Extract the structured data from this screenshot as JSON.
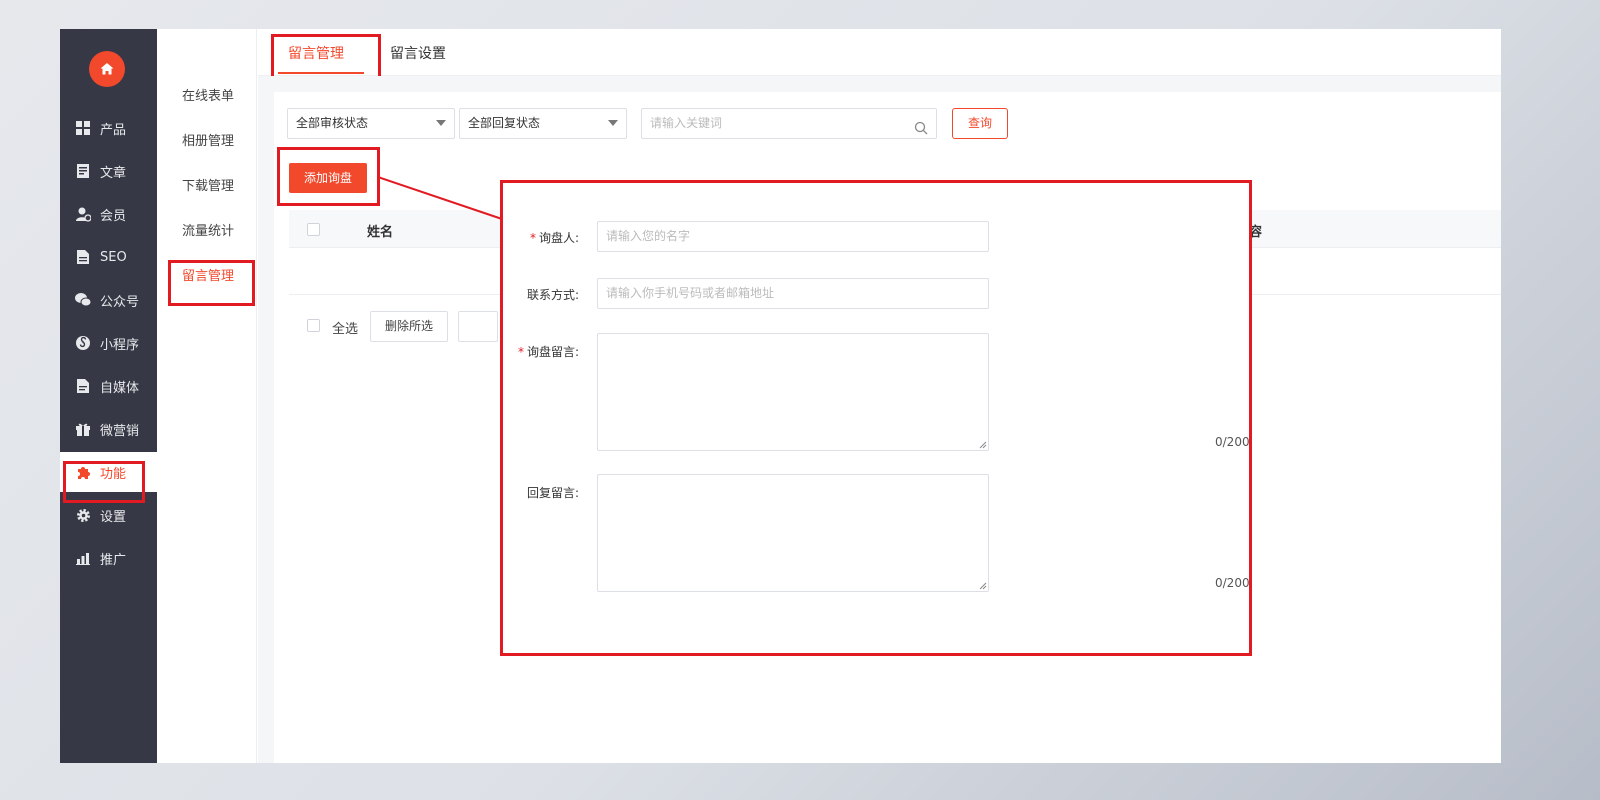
{
  "sidebar": {
    "items": [
      {
        "label": "产品",
        "icon": "grid-icon"
      },
      {
        "label": "文章",
        "icon": "document-icon"
      },
      {
        "label": "会员",
        "icon": "member-icon"
      },
      {
        "label": "SEO",
        "icon": "file-icon"
      },
      {
        "label": "公众号",
        "icon": "wechat-icon"
      },
      {
        "label": "小程序",
        "icon": "miniprogram-icon"
      },
      {
        "label": "自媒体",
        "icon": "media-icon"
      },
      {
        "label": "微营销",
        "icon": "gift-icon"
      },
      {
        "label": "功能",
        "icon": "puzzle-icon",
        "active": true
      },
      {
        "label": "设置",
        "icon": "gear-icon"
      },
      {
        "label": "推广",
        "icon": "chart-icon"
      }
    ]
  },
  "subnav": {
    "items": [
      {
        "label": "在线表单"
      },
      {
        "label": "相册管理"
      },
      {
        "label": "下载管理"
      },
      {
        "label": "流量统计"
      },
      {
        "label": "留言管理",
        "active": true
      }
    ]
  },
  "tabs": [
    {
      "label": "留言管理",
      "active": true
    },
    {
      "label": "留言设置"
    }
  ],
  "filters": {
    "audit_status": "全部审核状态",
    "reply_status": "全部回复状态",
    "keyword_placeholder": "请输入关键词",
    "query_label": "查询"
  },
  "add_button": "添加询盘",
  "table": {
    "columns": [
      "姓名",
      "容"
    ]
  },
  "bulk": {
    "select_all": "全选",
    "delete_selected": "删除所选"
  },
  "form": {
    "inquirer_label": "询盘人:",
    "inquirer_placeholder": "请输入您的名字",
    "contact_label": "联系方式:",
    "contact_placeholder": "请输入你手机号码或者邮箱地址",
    "message_label": "询盘留言:",
    "message_counter": "0/200",
    "reply_label": "回复留言:",
    "reply_counter": "0/200"
  },
  "colors": {
    "accent": "#f2492c",
    "highlight": "#e21b23",
    "sidebar_bg": "#363945"
  }
}
